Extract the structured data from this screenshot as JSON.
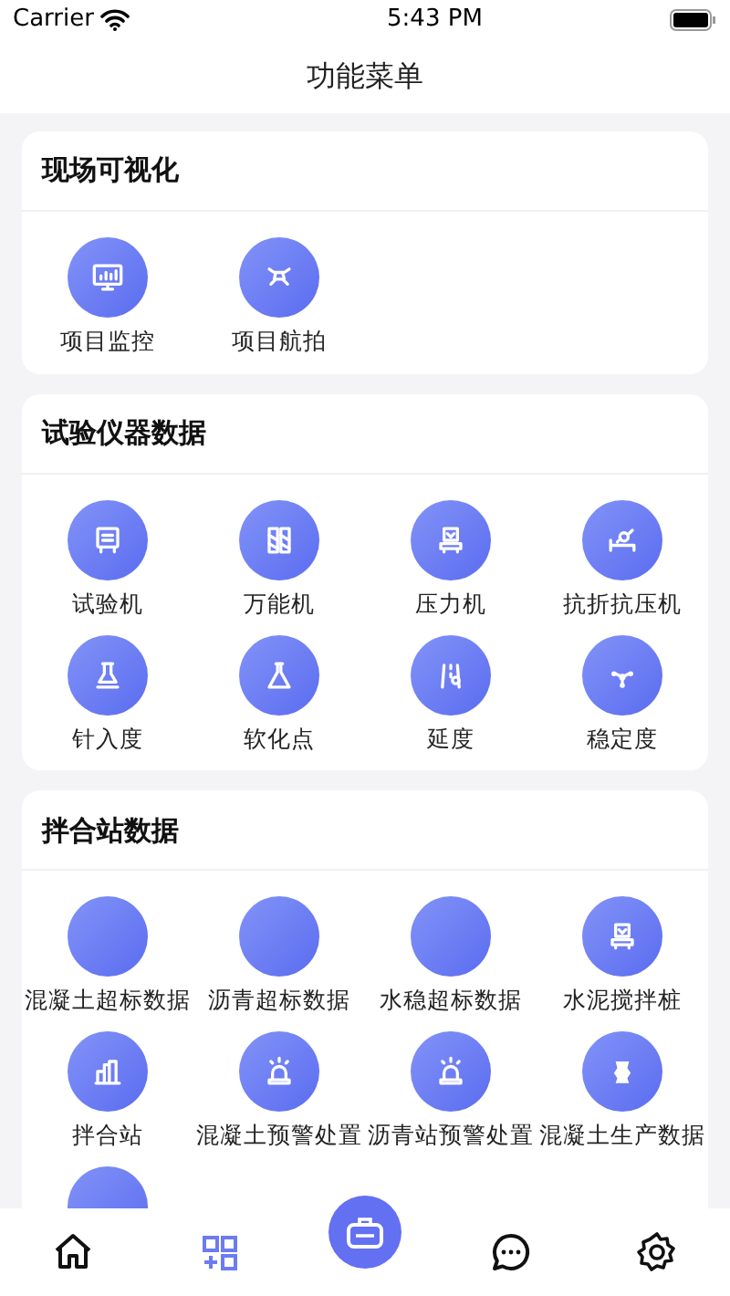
{
  "status_bar": {
    "carrier": "Carrier",
    "time": "5:43 PM"
  },
  "nav": {
    "title": "功能菜单"
  },
  "sections": [
    {
      "title": "现场可视化",
      "items": [
        {
          "kind": "tile",
          "label": "项目监控"
        },
        {
          "kind": "tile",
          "label": "项目航拍"
        }
      ]
    },
    {
      "title": "试验仪器数据",
      "items": [
        {
          "kind": "tile",
          "label": "试验机"
        },
        {
          "kind": "tile",
          "label": "万能机"
        },
        {
          "kind": "tile",
          "label": "压力机"
        },
        {
          "kind": "tile",
          "label": "抗折抗压机"
        },
        {
          "kind": "tile",
          "label": "针入度"
        },
        {
          "kind": "tile",
          "label": "软化点"
        },
        {
          "kind": "tile",
          "label": "延度"
        },
        {
          "kind": "tile",
          "label": "稳定度"
        }
      ]
    },
    {
      "title": "拌合站数据",
      "items": [
        {
          "kind": "tile",
          "label": "混凝土超标数据"
        },
        {
          "kind": "tile",
          "label": "沥青超标数据"
        },
        {
          "kind": "tile",
          "label": "水稳超标数据"
        },
        {
          "kind": "tile",
          "label": "水泥搅拌桩"
        },
        {
          "kind": "tile",
          "label": "拌合站"
        },
        {
          "kind": "tile",
          "label": "混凝土预警处置"
        },
        {
          "kind": "tile",
          "label": "沥青站预警处置"
        },
        {
          "kind": "tile",
          "label": "混凝土生产数据"
        },
        {
          "kind": "partial"
        }
      ]
    }
  ],
  "tab_bar": [
    {
      "kind": "tab",
      "selected": false
    },
    {
      "kind": "tab",
      "selected": true
    },
    {
      "kind": "center",
      "selected": false
    },
    {
      "kind": "tab",
      "selected": false
    },
    {
      "kind": "tab",
      "selected": false
    }
  ]
}
